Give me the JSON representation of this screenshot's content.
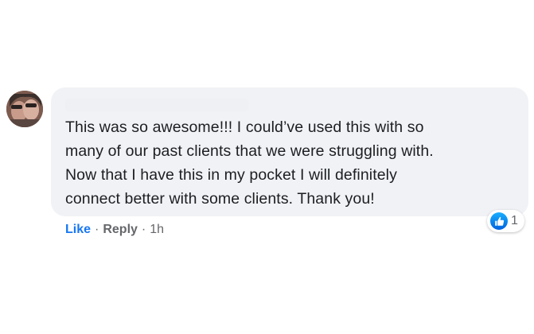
{
  "comment": {
    "author": "",
    "text": "This was so awesome!!! I could’ve used this with so\nmany of our past clients that we were struggling with.\nNow that I have this in my pocket I will definitely\nconnect better with some clients. Thank you!",
    "reaction": {
      "icon": "thumbs-up-icon",
      "count": "1",
      "color": "#1877f2"
    },
    "actions": {
      "like_label": "Like",
      "reply_label": "Reply",
      "separator": "·",
      "timestamp": "1h"
    }
  },
  "colors": {
    "bubble_bg": "#f0f2f5",
    "like_blue": "#1877f2",
    "meta_gray": "#65676b"
  }
}
